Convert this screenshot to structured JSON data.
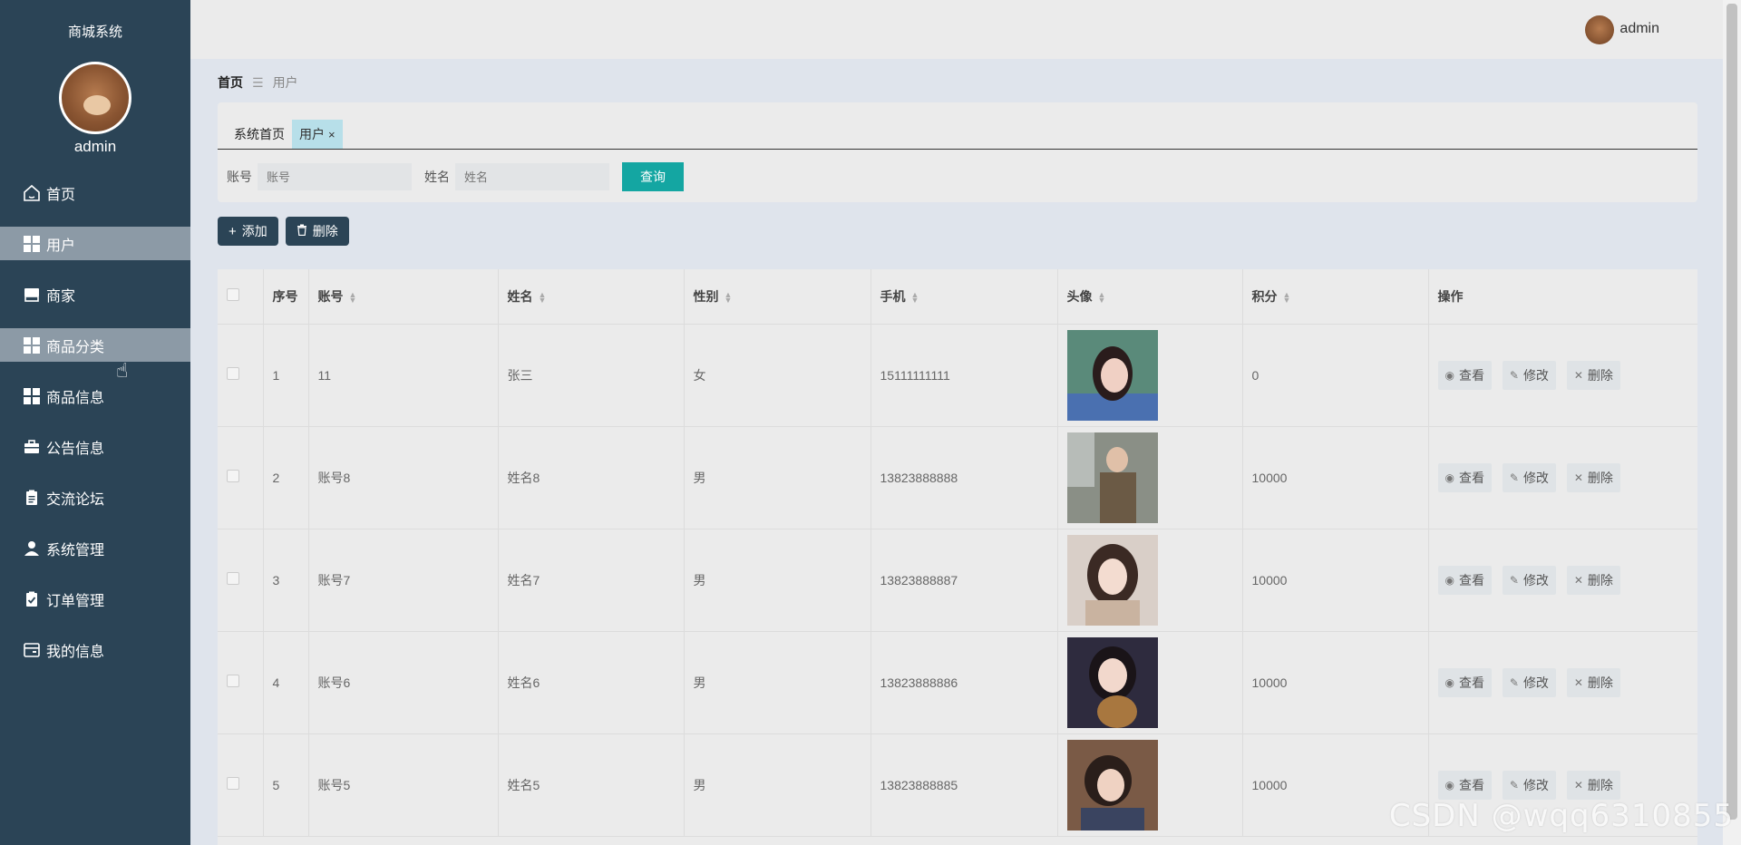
{
  "sidebar": {
    "system_title": "商城系统",
    "username": "admin",
    "items": [
      {
        "label": "首页",
        "icon": "home-icon"
      },
      {
        "label": "用户",
        "icon": "grid-icon"
      },
      {
        "label": "商家",
        "icon": "shop-icon"
      },
      {
        "label": "商品分类",
        "icon": "grid-icon"
      },
      {
        "label": "商品信息",
        "icon": "grid-icon"
      },
      {
        "label": "公告信息",
        "icon": "briefcase-icon"
      },
      {
        "label": "交流论坛",
        "icon": "clipboard-icon"
      },
      {
        "label": "系统管理",
        "icon": "person-icon"
      },
      {
        "label": "订单管理",
        "icon": "clipboard-check-icon"
      },
      {
        "label": "我的信息",
        "icon": "card-icon"
      }
    ]
  },
  "header": {
    "username": "admin"
  },
  "breadcrumb": {
    "home": "首页",
    "current": "用户"
  },
  "tabs": [
    {
      "label": "系统首页"
    },
    {
      "label": "用户",
      "close": "×"
    }
  ],
  "search": {
    "account_label": "账号",
    "account_placeholder": "账号",
    "name_label": "姓名",
    "name_placeholder": "姓名",
    "query_button": "查询"
  },
  "toolbar": {
    "add_label": "添加",
    "delete_label": "删除"
  },
  "table": {
    "headers": [
      "序号",
      "账号",
      "姓名",
      "性别",
      "手机",
      "头像",
      "积分",
      "操作"
    ],
    "rows": [
      {
        "index": "1",
        "account": "11",
        "name": "张三",
        "gender": "女",
        "phone": "15111111111",
        "points": "0"
      },
      {
        "index": "2",
        "account": "账号8",
        "name": "姓名8",
        "gender": "男",
        "phone": "13823888888",
        "points": "10000"
      },
      {
        "index": "3",
        "account": "账号7",
        "name": "姓名7",
        "gender": "男",
        "phone": "13823888887",
        "points": "10000"
      },
      {
        "index": "4",
        "account": "账号6",
        "name": "姓名6",
        "gender": "男",
        "phone": "13823888886",
        "points": "10000"
      },
      {
        "index": "5",
        "account": "账号5",
        "name": "姓名5",
        "gender": "男",
        "phone": "13823888885",
        "points": "10000"
      }
    ],
    "ops": {
      "view": "查看",
      "edit": "修改",
      "delete": "删除"
    }
  },
  "watermark": "CSDN @wqq6310855",
  "colors": {
    "sidebar_bg": "#2b4456",
    "active_item": "#8c9aa6",
    "query_btn": "#14a6a2",
    "tab_active": "#b7dfe9"
  }
}
